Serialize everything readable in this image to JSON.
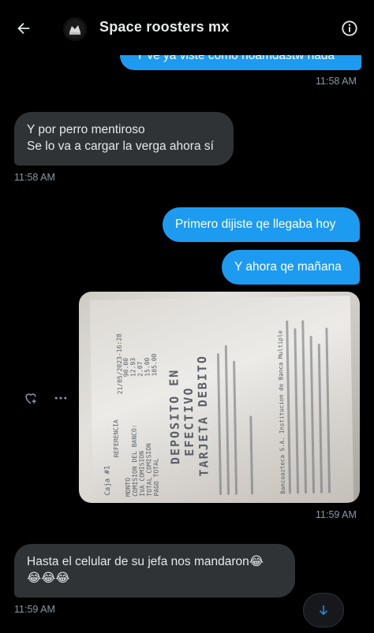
{
  "header": {
    "title": "Space roosters mx",
    "back_icon": "arrow-left-icon",
    "info_icon": "info-icon"
  },
  "messages": {
    "m1": {
      "text": "Y ve ya viste como noamdastw nada",
      "time": "11:58 AM"
    },
    "m2": {
      "line1": "Y por perro mentiroso",
      "line2": "Se lo va a cargar la verga ahora sí",
      "time": "11:58 AM"
    },
    "m3": {
      "text": "Primero dijiste qe llegaba hoy"
    },
    "m4": {
      "text": "Y ahora qe mañana"
    },
    "m5": {
      "receipt": {
        "lines": [
          "DEPOSITO EN",
          "EFECTIVO",
          "TARJETA DEBITO"
        ],
        "header_text": "Caja #1",
        "date_text": "21/05/2023-16:28",
        "ref_label": "REFERENCIA",
        "amounts": [
          "90.00",
          "12.93",
          "2.07",
          "15.00",
          "105.00"
        ],
        "labels": [
          "MONTO",
          "COMISION DEL BANCO:",
          "IVA COMISION",
          "TOTAL COMISION",
          "PAGO TOTAL"
        ],
        "footer": "Bancoazteca S.A. Institucion de Banca Multiple"
      },
      "time": "11:59 AM"
    },
    "m6": {
      "line1": "Hasta el celular de su jefa nos mandaron😂",
      "line2": "😂😂😂",
      "time": "11:59 AM"
    }
  },
  "icons": {
    "react": "heart-plus-icon",
    "more": "more-horizontal-icon",
    "scroll_down": "arrow-down-icon"
  },
  "colors": {
    "outgoing": "#1d9bf0",
    "incoming": "#2f3336",
    "background": "#000000",
    "timestamp": "#8b98a5"
  }
}
